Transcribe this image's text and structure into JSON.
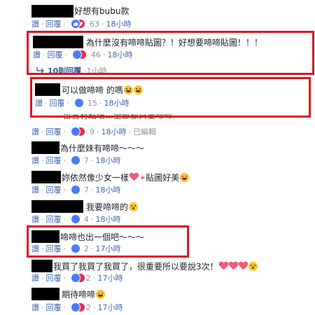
{
  "comments": [
    {
      "text": "好想有bubu款",
      "like": "讚",
      "reply": "回覆",
      "count": "63",
      "time": "18小時"
    },
    {
      "text": "為什麼沒有啼啼貼圖？！好想要啼啼貼圖！！！",
      "like": "讚",
      "reply": "回覆",
      "count": "46",
      "time": "18小時"
    },
    {
      "text": "可以做啼啼 的嗎",
      "like": "讚",
      "reply": "回覆",
      "count": "15",
      "time": "18小時"
    },
    {
      "text": "留言有點環…全部都只要啼啼",
      "like": "讚",
      "reply": "回覆",
      "count": "9",
      "time": "18小時",
      "edited": "已編輯"
    },
    {
      "text": "為什麼妹有啼啼～～～",
      "like": "讚",
      "reply": "回覆",
      "count": "7",
      "time": "18小時"
    },
    {
      "text": "妳依然像少女一樣",
      "text2": "貼圖好美",
      "like": "讚",
      "reply": "回覆",
      "count": "7",
      "time": "18小時"
    },
    {
      "text": "我要啼啼的",
      "like": "讚",
      "reply": "回覆",
      "count": "4",
      "time": "18小時"
    },
    {
      "text": "啼啼也出一個吧～～～",
      "like": "讚",
      "reply": "回覆",
      "count": "2",
      "time": "17小時"
    },
    {
      "text": "我買了我買了我買了，很重要所以要說3次！",
      "like": "讚",
      "reply": "回覆",
      "count": "2",
      "time": "17小時"
    },
    {
      "text": "期待啼啼",
      "like": "讚",
      "reply": "回覆",
      "count": "2",
      "time": "17小時"
    }
  ],
  "replies_link": {
    "label": "10則回覆",
    "time": "1小時"
  },
  "colors": {
    "highlight": "#e0141e",
    "link": "#4267b2",
    "meta": "#90949c"
  }
}
